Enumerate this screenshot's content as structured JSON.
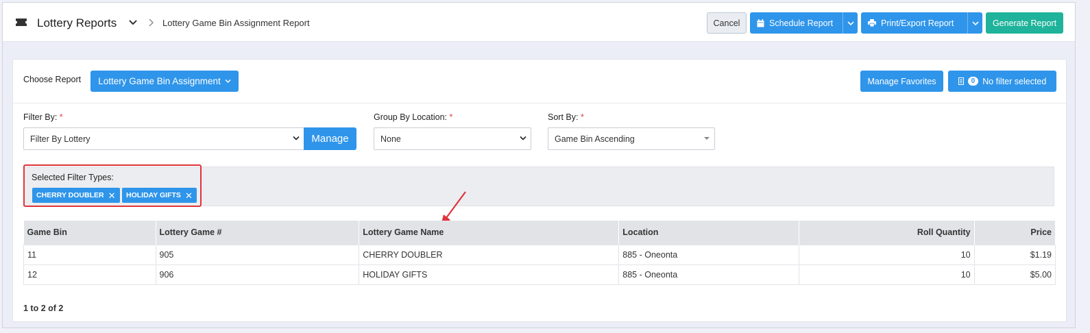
{
  "header": {
    "app_title": "Lottery Reports",
    "breadcrumb": "Lottery Game Bin Assignment Report",
    "cancel_label": "Cancel",
    "schedule_label": "Schedule Report",
    "print_label": "Print/Export Report",
    "generate_label": "Generate Report"
  },
  "controls": {
    "choose_report_label": "Choose Report",
    "choose_report_value": "Lottery Game Bin Assignment",
    "manage_favorites_label": "Manage Favorites",
    "filter_count": "0",
    "no_filter_label": "No filter selected",
    "filter_by_label": "Filter By:",
    "filter_by_value": "Filter By Lottery",
    "manage_label": "Manage",
    "group_by_label": "Group By Location:",
    "group_by_value": "None",
    "sort_by_label": "Sort By:",
    "sort_by_value": "Game Bin Ascending",
    "required_mark": "*"
  },
  "filters": {
    "title": "Selected Filter Types:",
    "chips": [
      {
        "label": "CHERRY DOUBLER",
        "remove": "✕"
      },
      {
        "label": "HOLIDAY GIFTS",
        "remove": "✕"
      }
    ]
  },
  "table": {
    "headers": [
      "Game Bin",
      "Lottery Game #",
      "Lottery Game Name",
      "Location",
      "Roll Quantity",
      "Price"
    ],
    "rows": [
      [
        "11",
        "905",
        "CHERRY DOUBLER",
        "885 - Oneonta",
        "10",
        "$1.19"
      ],
      [
        "12",
        "906",
        "HOLIDAY GIFTS",
        "885 - Oneonta",
        "10",
        "$5.00"
      ]
    ]
  },
  "pager": "1 to 2 of 2",
  "colors": {
    "primary": "#2f95ea",
    "generate": "#1eb39a",
    "highlight": "#e0333b"
  }
}
